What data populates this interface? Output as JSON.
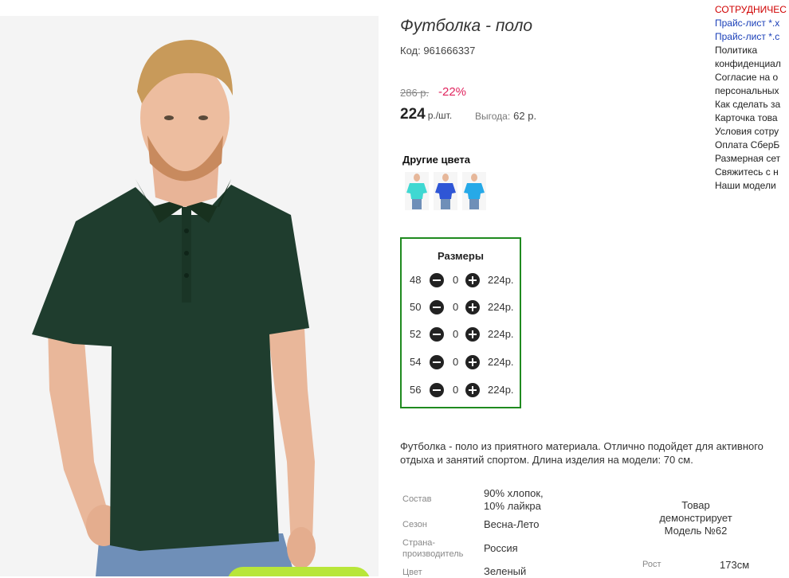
{
  "product": {
    "title": "Футболка - поло",
    "code": "Код: 961666337",
    "old_price": "286 р.",
    "discount": "-22%",
    "price": "224",
    "price_unit": "р./шт.",
    "saving_label": "Выгода:",
    "saving_value": "62 р.",
    "colors": {
      "title": "Другие цвета",
      "swatches": [
        {
          "color": "#3fd8d2",
          "icon": "tshirt-turquoise"
        },
        {
          "color": "#2f56d6",
          "icon": "tshirt-blue"
        },
        {
          "color": "#26a9e8",
          "icon": "tshirt-light-blue"
        }
      ]
    },
    "shirt_color": "#1f3d2e"
  },
  "sizes": {
    "title": "Размеры",
    "rows": [
      {
        "size": "48",
        "qty": "0",
        "price": "224р."
      },
      {
        "size": "50",
        "qty": "0",
        "price": "224р."
      },
      {
        "size": "52",
        "qty": "0",
        "price": "224р."
      },
      {
        "size": "54",
        "qty": "0",
        "price": "224р."
      },
      {
        "size": "56",
        "qty": "0",
        "price": "224р."
      }
    ]
  },
  "description": "Футболка - поло из приятного материала. Отлично подойдет для активного отдыха и занятий спортом. Длина изделия на модели: 70 см.",
  "specs": [
    {
      "label": "Состав",
      "value": "90% хлопок,\n10% лайкра"
    },
    {
      "label": "Сезон",
      "value": "Весна-Лето"
    },
    {
      "label": "Страна-\nпроизводитель",
      "value": "Россия"
    },
    {
      "label": "Цвет",
      "value": "Зеленый"
    }
  ],
  "model": {
    "line1": "Товар",
    "line2": "демонстрирует",
    "line3": "Модель №62",
    "height_label": "Рост",
    "height_value": "173см"
  },
  "side_menu": [
    {
      "label": "СОТРУДНИЧЕС",
      "style": "red"
    },
    {
      "label": "Прайс-лист *.x",
      "style": "blue"
    },
    {
      "label": "Прайс-лист *.c",
      "style": "blue"
    },
    {
      "label": "Политика",
      "style": "normal"
    },
    {
      "label": "конфиденциал",
      "style": "normal"
    },
    {
      "label": "Согласие на о",
      "style": "normal"
    },
    {
      "label": "персональных",
      "style": "normal"
    },
    {
      "label": "Как сделать за",
      "style": "normal"
    },
    {
      "label": "Карточка това",
      "style": "normal"
    },
    {
      "label": "Условия сотру",
      "style": "normal"
    },
    {
      "label": "Оплата СберБ",
      "style": "normal"
    },
    {
      "label": "Размерная сет",
      "style": "normal"
    },
    {
      "label": "Свяжитесь с н",
      "style": "normal"
    },
    {
      "label": "Наши модели",
      "style": "normal"
    }
  ],
  "colors": {
    "accent_green": "#1f8a1f",
    "discount_red": "#e0245e",
    "menu_red": "#d00000",
    "menu_blue": "#1a3fb8"
  }
}
